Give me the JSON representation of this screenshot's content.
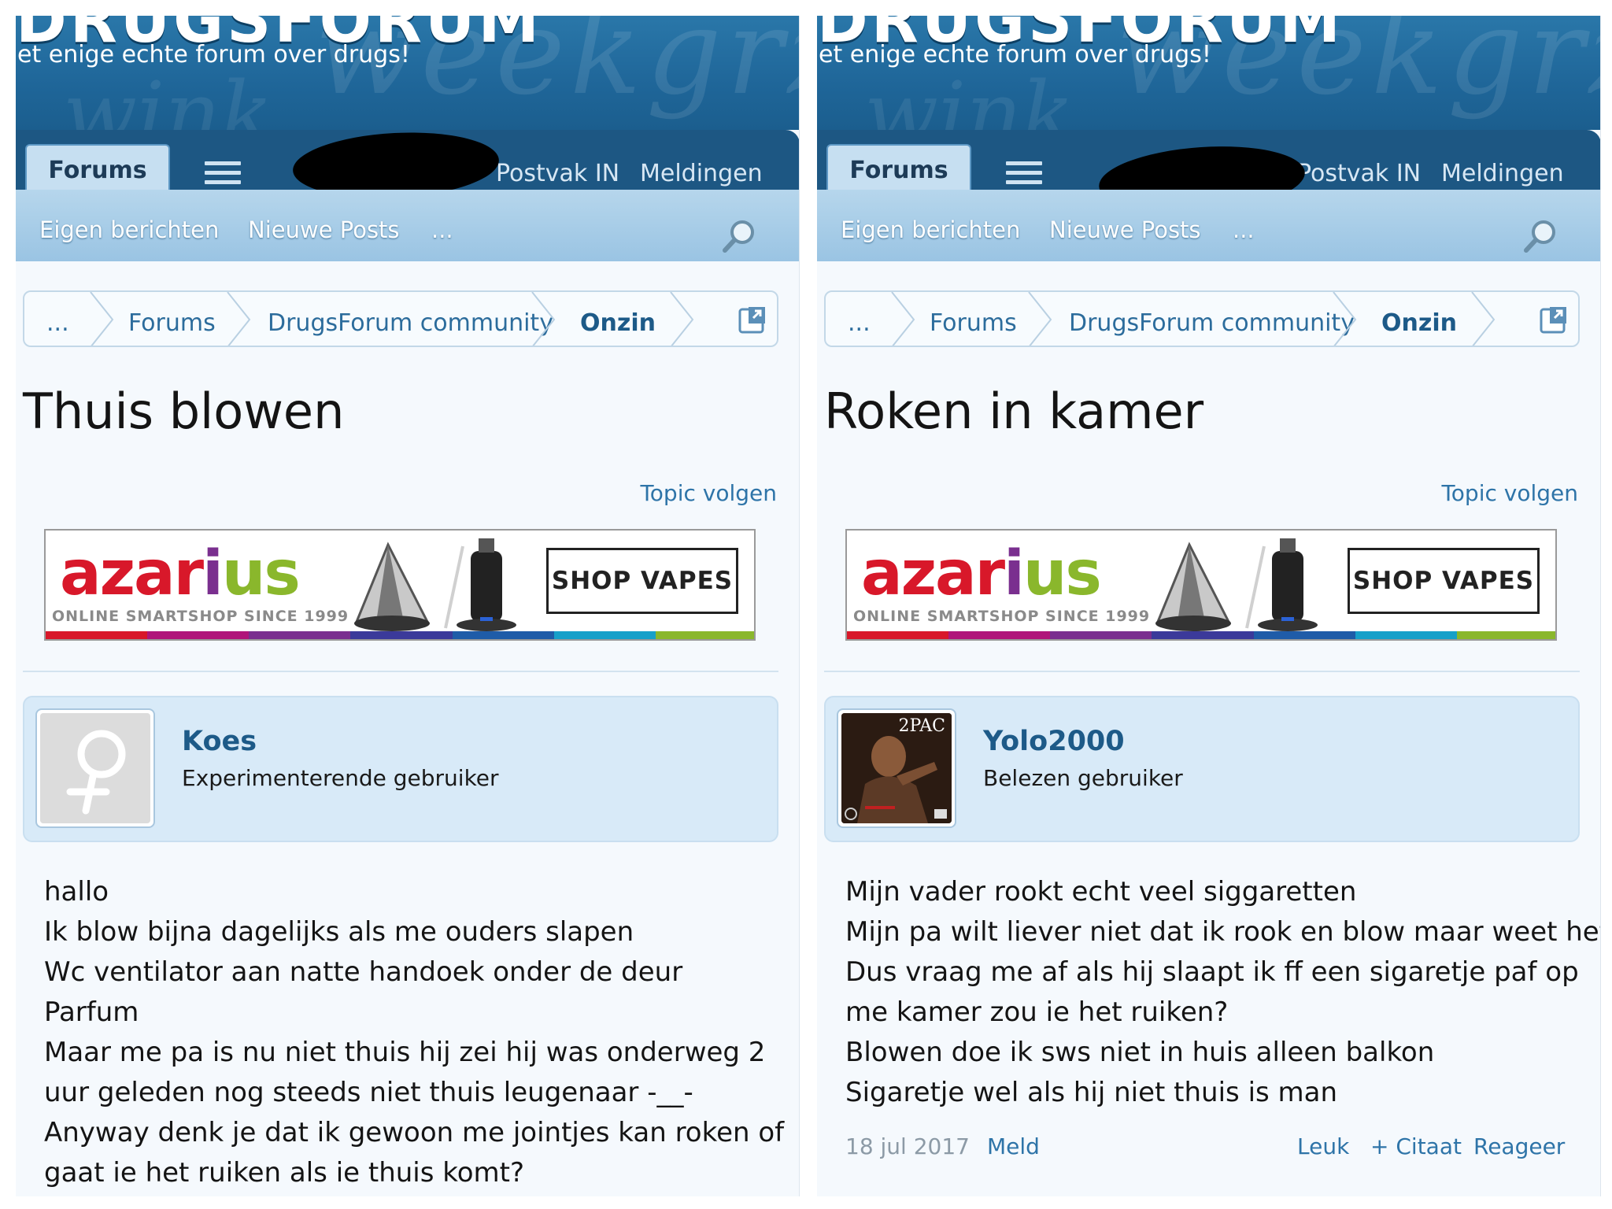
{
  "site": {
    "logo": "DRUGSFORUM",
    "tagline": "et enige echte forum over drugs!",
    "tabs": {
      "forums": "Forums",
      "inbox": "Postvak IN",
      "alerts": "Meldingen"
    },
    "subnav": {
      "own_posts": "Eigen berichten",
      "new_posts": "Nieuwe Posts",
      "more": "..."
    }
  },
  "colors": {
    "header_blue": "#1f6699",
    "tabbar_navy": "#1d5783",
    "link_blue": "#2e74a8",
    "card_blue": "#d8eaf8"
  },
  "ad": {
    "logo": "azarius",
    "subtitle": "ONLINE SMARTSHOP SINCE 1999",
    "button": "SHOP VAPES"
  },
  "panels": [
    {
      "breadcrumb": [
        "...",
        "Forums",
        "DrugsForum community",
        "Onzin"
      ],
      "title": "Thuis blowen",
      "follow": "Topic volgen",
      "user": {
        "name": "Koes",
        "title": "Experimenterende gebruiker",
        "avatar": "female-symbol-icon"
      },
      "post_lines": [
        "hallo",
        "Ik blow bijna dagelijks als me ouders slapen",
        "Wc ventilator aan natte handoek onder de deur",
        "Parfum",
        "Maar me pa is nu niet thuis hij zei hij was onderweg 2",
        "uur geleden nog steeds niet thuis leugenaar -__-",
        "Anyway denk je dat ik gewoon me jointjes kan roken of",
        "gaat ie het ruiken als ie thuis komt?"
      ]
    },
    {
      "breadcrumb": [
        "...",
        "Forums",
        "DrugsForum community",
        "Onzin"
      ],
      "title": "Roken in kamer",
      "follow": "Topic volgen",
      "user": {
        "name": "Yolo2000",
        "title": "Belezen gebruiker",
        "avatar": "album-cover-avatar",
        "avatar_text": "2PAC"
      },
      "post_lines": [
        "Mijn vader rookt echt veel siggaretten",
        "Mijn pa wilt liever niet dat ik rook en blow maar weet het",
        "Dus vraag me af als hij slaapt ik ff een sigaretje paf op",
        "me kamer zou ie het ruiken?",
        "Blowen doe ik sws niet in huis alleen balkon",
        "Sigaretje wel als hij niet thuis is man"
      ],
      "footer": {
        "date": "18 jul 2017",
        "report": "Meld",
        "like": "Leuk",
        "quote": "+ Citaat",
        "reply": "Reageer"
      }
    }
  ]
}
